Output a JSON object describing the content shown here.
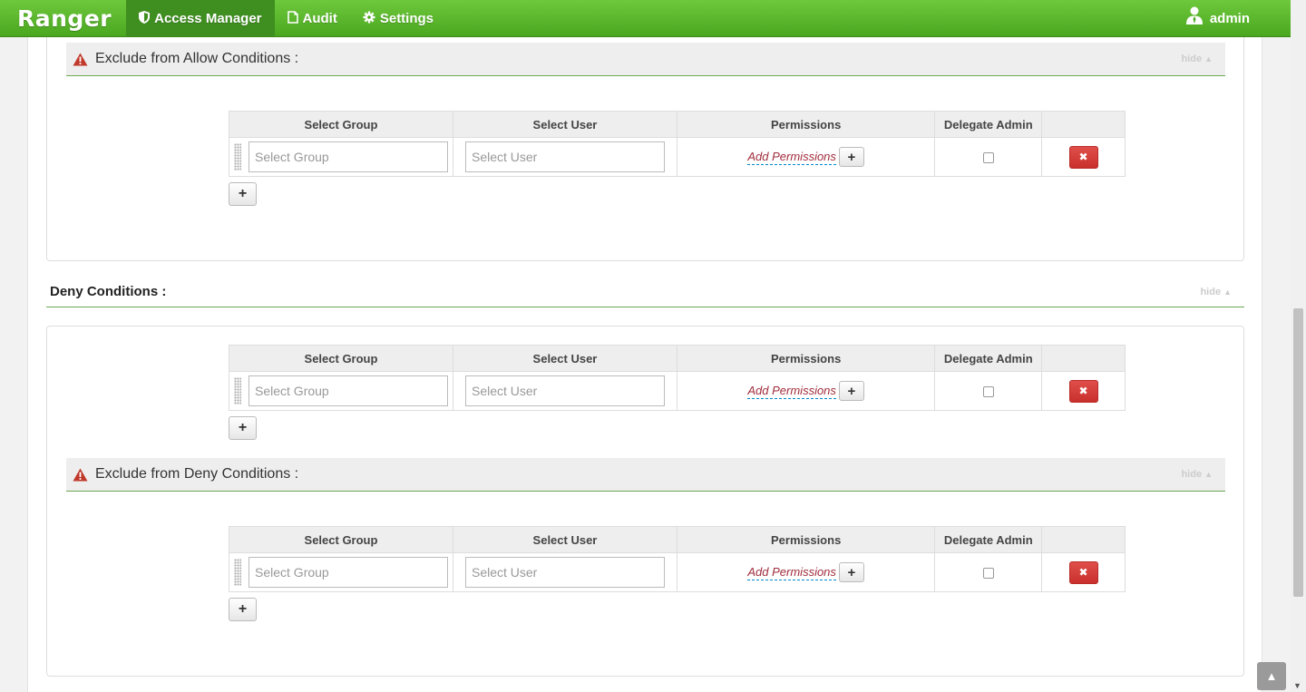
{
  "navbar": {
    "brand": "Ranger",
    "items": [
      {
        "label": "Access Manager",
        "icon": "shield-icon",
        "active": true
      },
      {
        "label": "Audit",
        "icon": "file-icon",
        "active": false
      },
      {
        "label": "Settings",
        "icon": "gear-icon",
        "active": false
      }
    ],
    "user": "admin"
  },
  "colors": {
    "navbar": "#5cb82e",
    "danger": "#d9534f",
    "section_border": "#6aa84f"
  },
  "hide_label": "hide",
  "table_headers": {
    "group": "Select Group",
    "user": "Select User",
    "permissions": "Permissions",
    "delegate": "Delegate Admin"
  },
  "row": {
    "group_placeholder": "Select Group",
    "user_placeholder": "Select User",
    "add_permissions": "Add Permissions"
  },
  "sections": {
    "exclude_allow": {
      "title": "Exclude from Allow Conditions :"
    },
    "deny": {
      "title": "Deny Conditions :"
    },
    "exclude_deny": {
      "title": "Exclude from Deny Conditions :"
    }
  }
}
